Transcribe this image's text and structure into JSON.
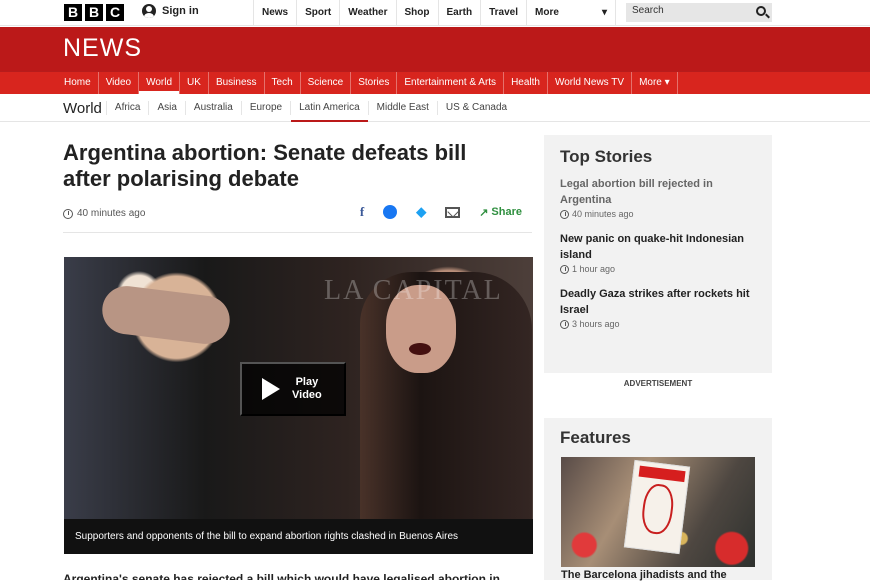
{
  "top": {
    "logo_letters": [
      "B",
      "B",
      "C"
    ],
    "signin_label": "Sign in",
    "nav": [
      "News",
      "Sport",
      "Weather",
      "Shop",
      "Earth",
      "Travel"
    ],
    "more_label": "More",
    "search_placeholder": "Search"
  },
  "masthead": {
    "title": "NEWS",
    "nav": [
      "Home",
      "Video",
      "World",
      "UK",
      "Business",
      "Tech",
      "Science",
      "Stories",
      "Entertainment & Arts",
      "Health",
      "World News TV",
      "More ▾"
    ],
    "active_index": 2
  },
  "subnav": {
    "section": "World",
    "items": [
      "Africa",
      "Asia",
      "Australia",
      "Europe",
      "Latin America",
      "Middle East",
      "US & Canada"
    ],
    "active_index": 4
  },
  "article": {
    "headline": "Argentina abortion: Senate defeats bill after polarising debate",
    "time": "40 minutes ago",
    "share_label": "Share",
    "play_label_1": "Play",
    "play_label_2": "Video",
    "caption": "Supporters and opponents of the bill to expand abortion rights clashed in Buenos Aires",
    "body_start": "Argentina's senate has rejected a bill which would have legalised abortion in"
  },
  "top_stories": {
    "title": "Top Stories",
    "items": [
      {
        "title": "Legal abortion bill rejected in Argentina",
        "time": "40 minutes ago"
      },
      {
        "title": "New panic on quake-hit Indonesian island",
        "time": "1 hour ago"
      },
      {
        "title": "Deadly Gaza strikes after rockets hit Israel",
        "time": "3 hours ago"
      }
    ]
  },
  "advertisement_label": "ADVERTISEMENT",
  "features": {
    "title": "Features",
    "story_title": "The Barcelona jihadists and the"
  },
  "icons": {
    "search": "search-icon",
    "user": "user-icon",
    "clock": "clock-icon",
    "play": "play-icon",
    "share": "share-icon"
  },
  "colors": {
    "masthead_red": "#bb1919",
    "nav_red": "#d8251e",
    "share_blue": "#1380a1",
    "share_green": "#2f8f3f"
  }
}
